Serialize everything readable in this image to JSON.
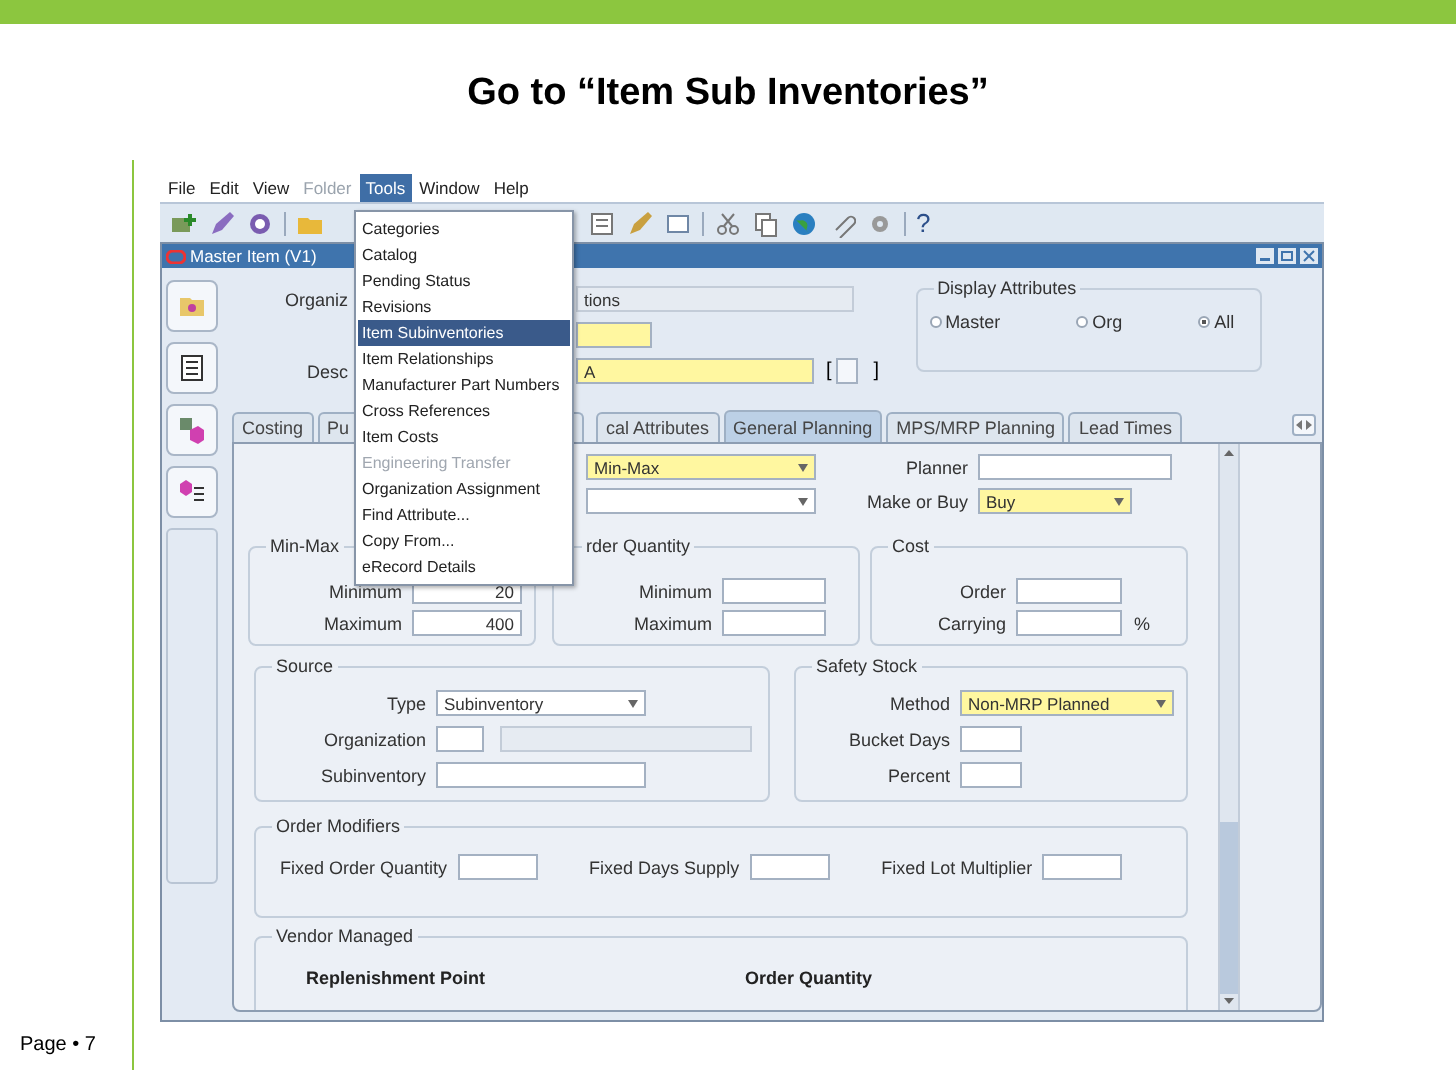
{
  "slide": {
    "title": "Go to “Item Sub Inventories”",
    "footer": "Page • 7"
  },
  "menu_bar": [
    {
      "label": "File",
      "selected": false,
      "disabled": false
    },
    {
      "label": "Edit",
      "selected": false,
      "disabled": false
    },
    {
      "label": "View",
      "selected": false,
      "disabled": false
    },
    {
      "label": "Folder",
      "selected": false,
      "disabled": true
    },
    {
      "label": "Tools",
      "selected": true,
      "disabled": false
    },
    {
      "label": "Window",
      "selected": false,
      "disabled": false
    },
    {
      "label": "Help",
      "selected": false,
      "disabled": false
    }
  ],
  "tools_menu": [
    {
      "label": "Categories",
      "selected": false,
      "disabled": false
    },
    {
      "label": "Catalog",
      "selected": false,
      "disabled": false
    },
    {
      "label": "Pending Status",
      "selected": false,
      "disabled": false
    },
    {
      "label": "Revisions",
      "selected": false,
      "disabled": false
    },
    {
      "label": "Item Subinventories",
      "selected": true,
      "disabled": false
    },
    {
      "label": "Item Relationships",
      "selected": false,
      "disabled": false
    },
    {
      "label": "Manufacturer Part Numbers",
      "selected": false,
      "disabled": false
    },
    {
      "label": "Cross References",
      "selected": false,
      "disabled": false
    },
    {
      "label": "Item Costs",
      "selected": false,
      "disabled": false
    },
    {
      "label": "Engineering Transfer",
      "selected": false,
      "disabled": true
    },
    {
      "label": "Organization Assignment",
      "selected": false,
      "disabled": false
    },
    {
      "label": "Find Attribute...",
      "selected": false,
      "disabled": false
    },
    {
      "label": "Copy From...",
      "selected": false,
      "disabled": false
    },
    {
      "label": "eRecord Details",
      "selected": false,
      "disabled": false
    }
  ],
  "toolbar": {
    "help": "?"
  },
  "window": {
    "title": "Master Item (V1)"
  },
  "header": {
    "organization": {
      "label": "Organiz",
      "value": "tions"
    },
    "item": {
      "required": true
    },
    "description": {
      "label": "Desc",
      "value": "A",
      "required": true,
      "brackets": [
        "[",
        "]"
      ]
    },
    "display_attributes": {
      "title": "Display Attributes",
      "options": [
        {
          "label": "Master",
          "selected": false
        },
        {
          "label": "Org",
          "selected": false
        },
        {
          "label": "All",
          "selected": true
        }
      ]
    }
  },
  "tabs": [
    {
      "label": "Costing",
      "selected": false
    },
    {
      "label": "Pu",
      "selected": false
    },
    {
      "label": "cal Attributes",
      "selected": false
    },
    {
      "label": "General Planning",
      "selected": true
    },
    {
      "label": "MPS/MRP Planning",
      "selected": false
    },
    {
      "label": "Lead Times",
      "selected": false
    }
  ],
  "panel": {
    "planning_method": {
      "value": "Min-Max",
      "required": true
    },
    "planner": {
      "label": "Planner"
    },
    "make_or_buy": {
      "label": "Make or Buy",
      "value": "Buy",
      "required": true
    },
    "min_max_quantity": {
      "title": "Min-Max",
      "rows": [
        {
          "label": "Minimum",
          "value": "20"
        },
        {
          "label": "Maximum",
          "value": "400"
        }
      ]
    },
    "order_quantity": {
      "title": "rder Quantity",
      "rows": [
        {
          "label": "Minimum"
        },
        {
          "label": "Maximum"
        }
      ]
    },
    "cost": {
      "title": "Cost",
      "rows": [
        {
          "label": "Order"
        },
        {
          "label": "Carrying",
          "unit": "%"
        }
      ]
    },
    "source": {
      "title": "Source",
      "type": {
        "label": "Type",
        "value": "Subinventory"
      },
      "organization": {
        "label": "Organization"
      },
      "subinventory": {
        "label": "Subinventory"
      }
    },
    "safety_stock": {
      "title": "Safety Stock",
      "rows": [
        {
          "label": "Method",
          "value": "Non-MRP Planned",
          "kind": "select",
          "required": true
        },
        {
          "label": "Bucket Days",
          "kind": "text"
        },
        {
          "label": "Percent",
          "kind": "text"
        }
      ]
    },
    "order_modifiers": {
      "title": "Order Modifiers",
      "fields": [
        {
          "label": "Fixed Order Quantity"
        },
        {
          "label": "Fixed Days Supply"
        },
        {
          "label": "Fixed Lot Multiplier"
        }
      ]
    },
    "vendor_managed": {
      "title": "Vendor Managed",
      "columns": [
        "Replenishment Point",
        "Order Quantity"
      ]
    }
  }
}
